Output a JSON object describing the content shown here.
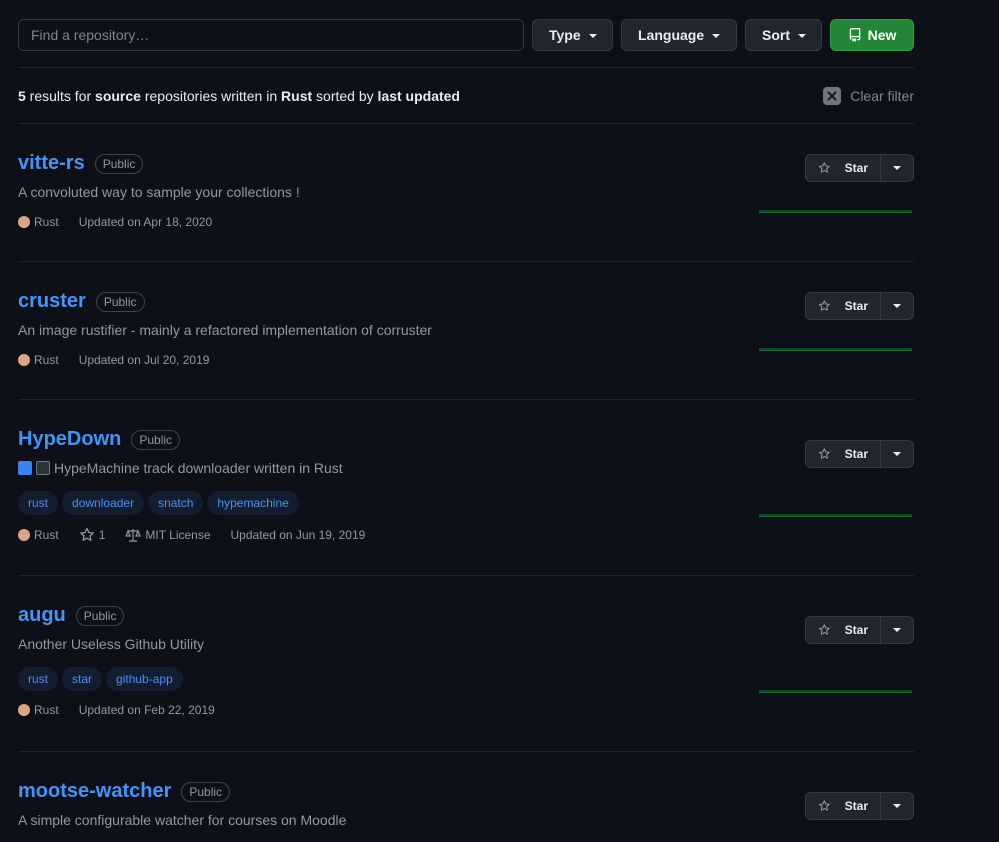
{
  "filter": {
    "search_placeholder": "Find a repository…",
    "type_label": "Type",
    "language_label": "Language",
    "sort_label": "Sort",
    "new_label": "New"
  },
  "summary": {
    "count": "5",
    "t1": " results for ",
    "type": "source",
    "t2": " repositories written in ",
    "language": "Rust",
    "t3": " sorted by ",
    "sort": "last updated",
    "clear_label": "Clear filter"
  },
  "repos": [
    {
      "name": "vitte-rs",
      "visibility": "Public",
      "description": "A convoluted way to sample your collections !",
      "language": "Rust",
      "updated": "Updated on Apr 18, 2020",
      "star_label": "Star"
    },
    {
      "name": "cruster",
      "visibility": "Public",
      "description": "An image rustifier - mainly a refactored implementation of corruster",
      "language": "Rust",
      "updated": "Updated on Jul 20, 2019",
      "star_label": "Star"
    },
    {
      "name": "HypeDown",
      "visibility": "Public",
      "description": "HypeMachine track downloader written in Rust",
      "topics": [
        "rust",
        "downloader",
        "snatch",
        "hypemachine"
      ],
      "language": "Rust",
      "stars": "1",
      "license": "MIT License",
      "updated": "Updated on Jun 19, 2019",
      "star_label": "Star"
    },
    {
      "name": "augu",
      "visibility": "Public",
      "description": "Another Useless Github Utility",
      "topics": [
        "rust",
        "star",
        "github-app"
      ],
      "language": "Rust",
      "updated": "Updated on Feb 22, 2019",
      "star_label": "Star"
    },
    {
      "name": "mootse-watcher",
      "visibility": "Public",
      "description": "A simple configurable watcher for courses on Moodle",
      "star_label": "Star"
    }
  ],
  "colors": {
    "accent": "#4493f8",
    "rust": "#dea584",
    "primary_button": "#238636",
    "background": "#0d1117"
  }
}
